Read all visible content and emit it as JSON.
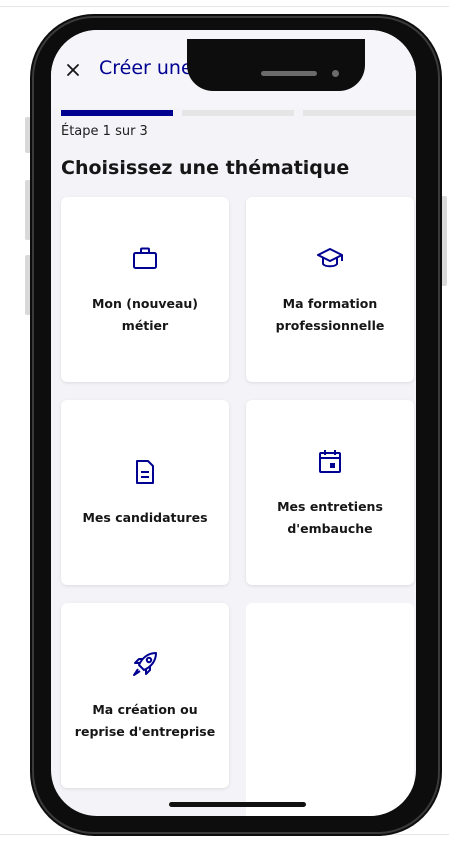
{
  "header": {
    "title": "Créer une démarche",
    "close_icon": "close-icon"
  },
  "stepper": {
    "label": "Étape 1 sur 3",
    "current_step": 1,
    "total_steps": 3
  },
  "section": {
    "title": "Choisissez une thématique"
  },
  "cards": [
    {
      "label": "Mon (nouveau)\nmétier",
      "icon": "briefcase-icon"
    },
    {
      "label": "Ma formation\nprofessionnelle",
      "icon": "graduation-cap-icon"
    },
    {
      "label": "Mes candidatures",
      "icon": "document-icon"
    },
    {
      "label": "Mes entretiens\nd'embauche",
      "icon": "calendar-icon"
    },
    {
      "label": "Ma création ou\nreprise d'entreprise",
      "icon": "rocket-icon"
    }
  ],
  "colors": {
    "accent": "#000091",
    "step_inactive": "#e5e5e5",
    "screen_background": "#f3f3f8",
    "card_background": "#ffffff"
  }
}
